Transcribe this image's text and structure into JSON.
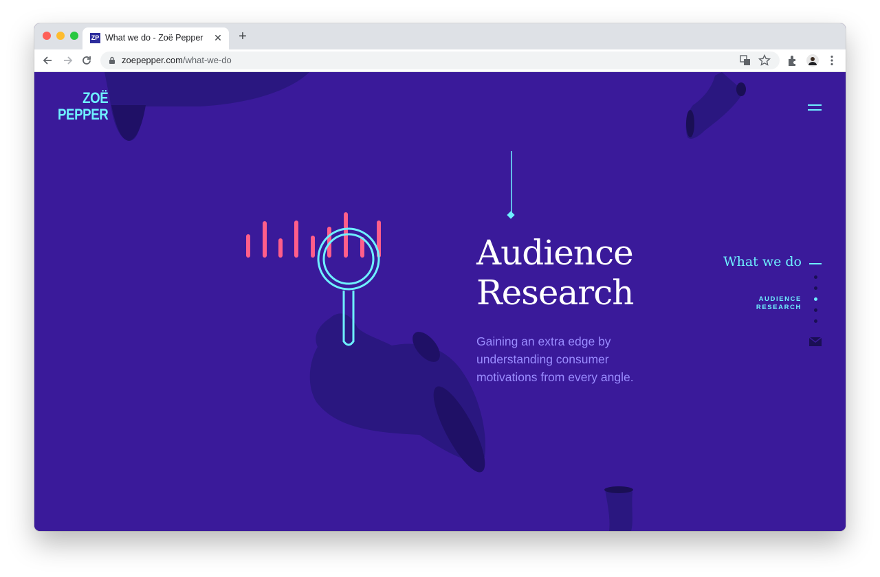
{
  "browser": {
    "tab_title": "What we do - Zoë Pepper",
    "tab_favicon": "ZP",
    "url_host": "zoepepper.com",
    "url_path": "/what-we-do",
    "icons": [
      "back-icon",
      "forward-icon",
      "reload-icon",
      "lock-icon",
      "translate-icon",
      "star-icon",
      "extensions-icon",
      "profile-avatar",
      "menu-icon",
      "close-icon",
      "new-tab-icon"
    ]
  },
  "site": {
    "logo_line1": "ZOË",
    "logo_line2": "PEPPER",
    "headline_line1": "Audience",
    "headline_line2": "Research",
    "description": "Gaining an extra edge by understanding consumer motivations from every angle.",
    "side_nav": {
      "section_title": "What we do",
      "current_line1": "AUDIENCE",
      "current_line2": "RESEARCH"
    },
    "colors": {
      "background": "#3a1a9a",
      "accent": "#6ef0ff",
      "bars": "#ff5e8a",
      "shape": "#2a1780",
      "text_muted": "#9a8cff"
    }
  }
}
